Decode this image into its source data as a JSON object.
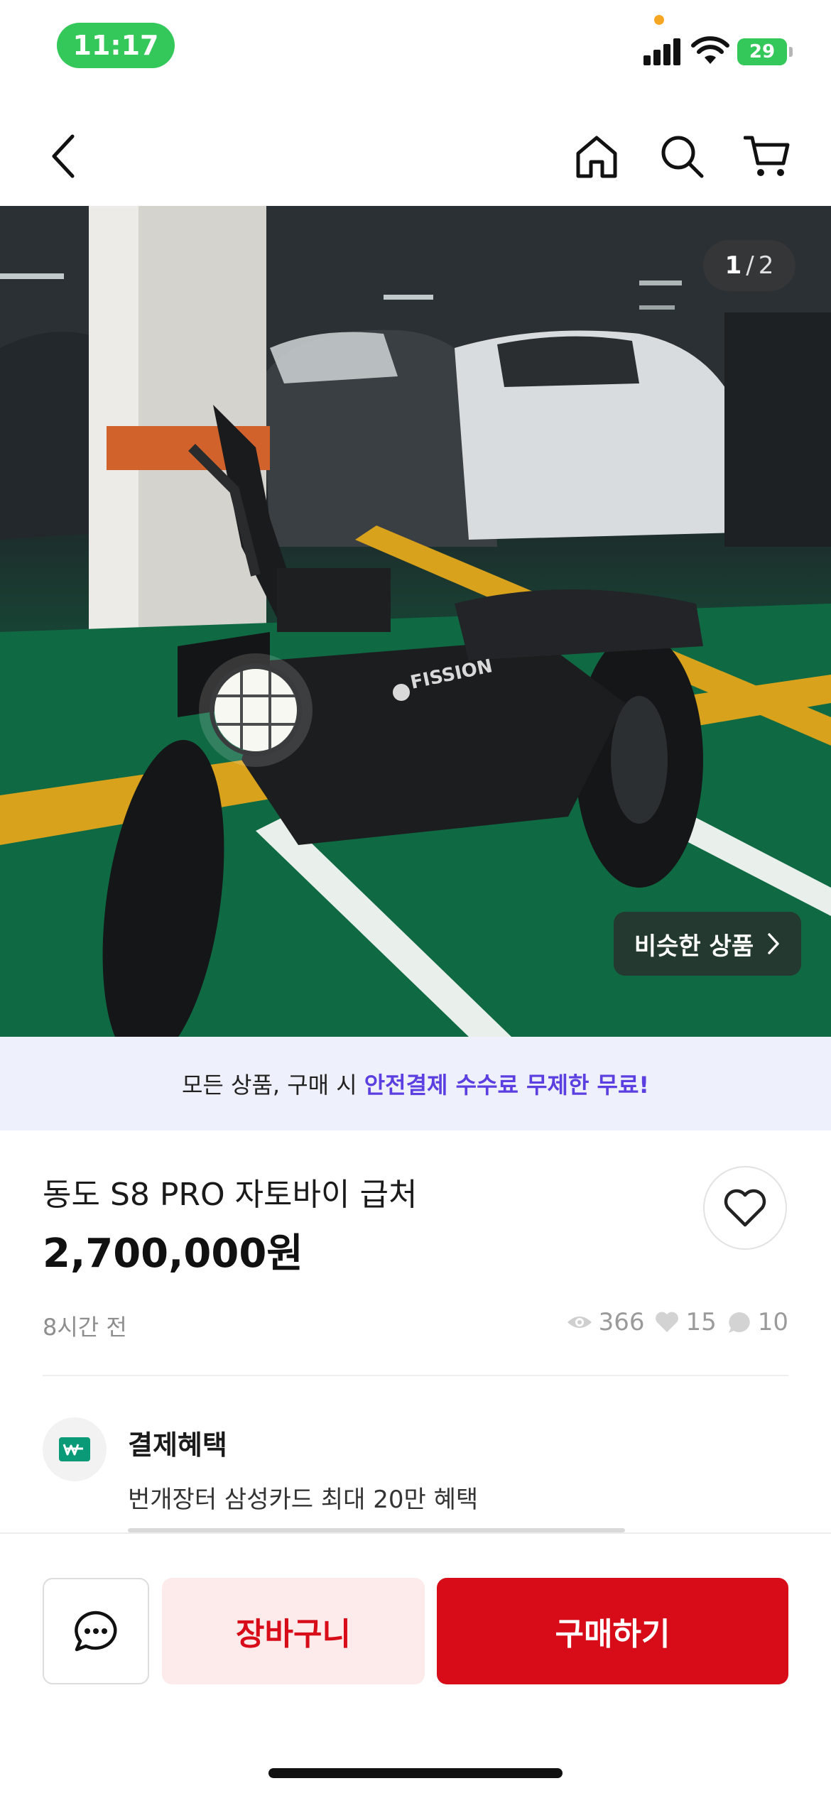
{
  "status_bar": {
    "time": "11:17",
    "battery": "29"
  },
  "nav": {
    "icons": [
      "back-icon",
      "home-icon",
      "search-icon",
      "cart-icon"
    ]
  },
  "hero": {
    "pager_current": "1",
    "pager_sep": "/",
    "pager_total": "2",
    "brand_text": "FISSION",
    "similar_label": "비슷한 상품"
  },
  "promo": {
    "text": "모든 상품, 구매 시",
    "accent": "안전결제 수수료 무제한 무료!"
  },
  "product": {
    "title": "동도 S8 PRO 자토바이 급처",
    "price": "2,700,000원",
    "posted": "8시간 전",
    "views": "366",
    "likes": "15",
    "comments": "10"
  },
  "benefit": {
    "title": "결제혜택",
    "description": "번개장터 삼성카드 최대 20만 혜택"
  },
  "bottom_bar": {
    "cart_label": "장바구니",
    "buy_label": "구매하기"
  },
  "colors": {
    "accent_red": "#d80c18",
    "promo_purple": "#5b3fe0",
    "status_green": "#34c759"
  }
}
